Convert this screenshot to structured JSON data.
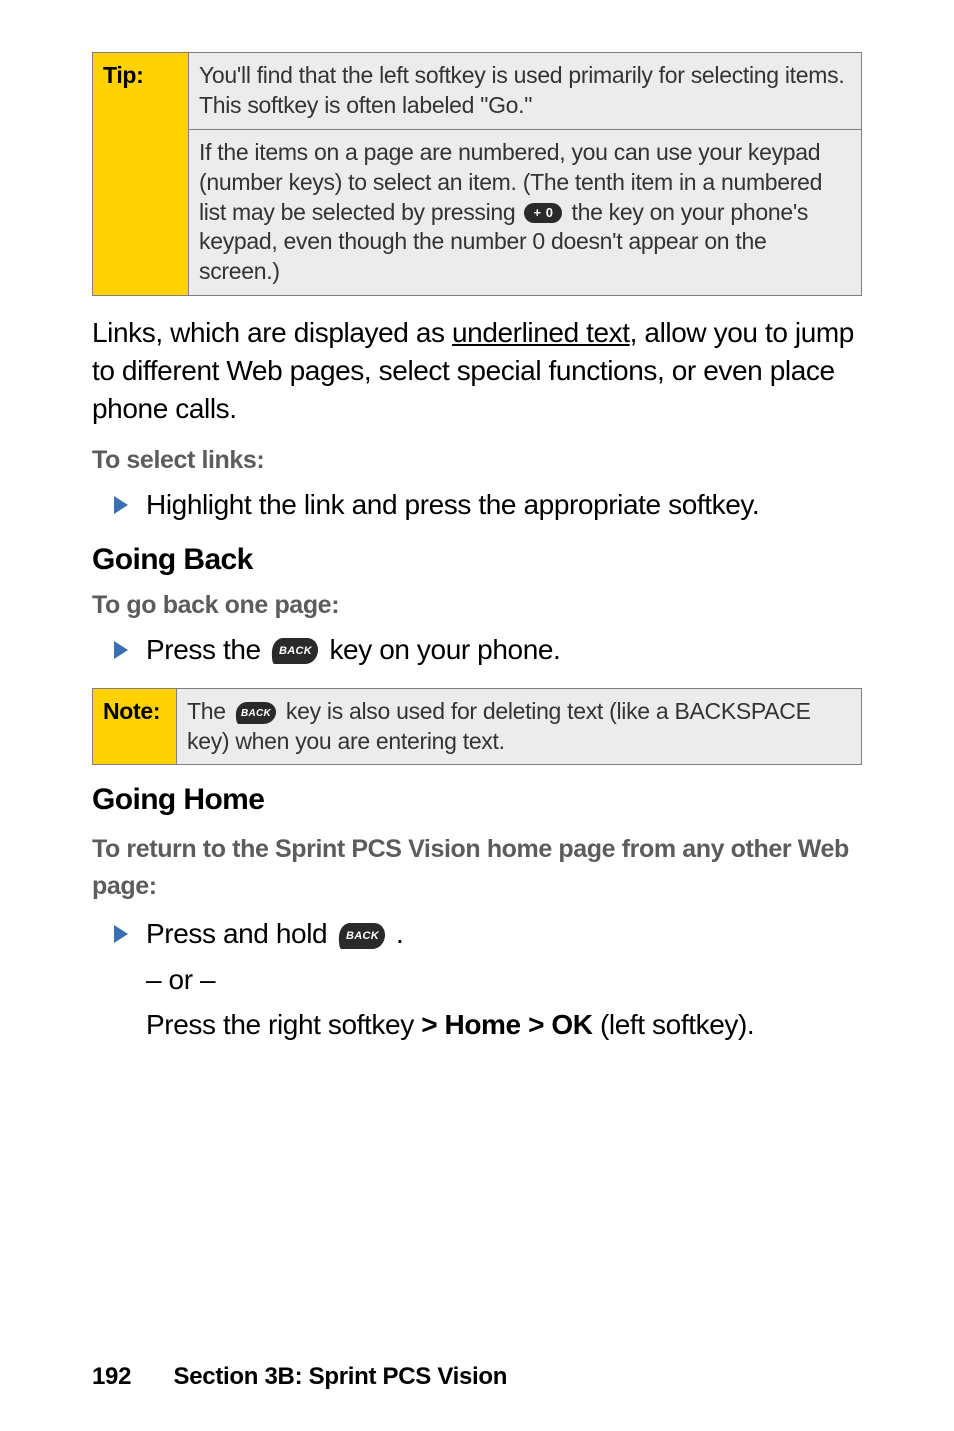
{
  "tip": {
    "label": "Tip:",
    "cell1_a": "You'll find that the left softkey is used primarily for selecting items. This softkey is often labeled \"Go.\"",
    "cell2_a": "If the items on a page are numbered, you can use your keypad (number keys) to select an item. (The tenth item in a numbered list may be selected by pressing ",
    "cell2_key": "+ 0",
    "cell2_b": " the key on your phone's keypad, even though the number 0 doesn't appear on the screen.)"
  },
  "para_links_a": "Links, which are displayed as ",
  "para_links_underlined": "underlined text",
  "para_links_b": ", allow you to jump to different Web pages, select special functions, or even place phone calls.",
  "sub_select_links": "To select links:",
  "bullet_select_links": "Highlight the link and press the appropriate softkey.",
  "h_going_back": "Going Back",
  "sub_go_back": "To go back one page:",
  "bullet_back_a": "Press the ",
  "bullet_back_key": "BACK",
  "bullet_back_b": " key on your phone.",
  "note": {
    "label": "Note:",
    "a": "The ",
    "key": "BACK",
    "b": " key is also used for deleting text (like a BACKSPACE key) when you are entering text."
  },
  "h_going_home": "Going Home",
  "sub_return_home": "To return to the Sprint PCS Vision home page from any other Web page:",
  "bullet_home_a": "Press and hold ",
  "bullet_home_key": "BACK",
  "bullet_home_b": " .",
  "or_text": "– or –",
  "softkey_line_a": "Press the right softkey ",
  "softkey_line_b": "> Home > OK",
  "softkey_line_c": " (left softkey).",
  "footer": {
    "page": "192",
    "section": "Section 3B: Sprint PCS Vision"
  }
}
